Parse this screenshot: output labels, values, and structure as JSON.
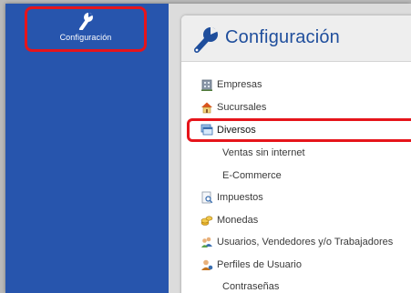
{
  "sidebar": {
    "item": {
      "label": "Configuración",
      "icon": "wrench-icon"
    }
  },
  "header": {
    "title": "Configuración",
    "icon": "wrench-icon"
  },
  "menu": {
    "items": [
      {
        "label": "Empresas",
        "icon": "building-icon"
      },
      {
        "label": "Sucursales",
        "icon": "house-icon"
      },
      {
        "label": "Diversos",
        "icon": "window-stack-icon"
      },
      {
        "label": "Ventas sin internet"
      },
      {
        "label": "E-Commerce"
      },
      {
        "label": "Impuestos",
        "icon": "document-search-icon"
      },
      {
        "label": "Monedas",
        "icon": "coins-icon"
      },
      {
        "label": "Usuarios, Vendedores y/o Trabajadores",
        "icon": "users-icon"
      },
      {
        "label": "Perfiles de Usuario",
        "icon": "user-profile-icon"
      },
      {
        "label": "Contraseñas"
      }
    ]
  },
  "colors": {
    "sidebar": "#2755ad",
    "title": "#1f4e9c",
    "highlight": "#e6141b"
  }
}
